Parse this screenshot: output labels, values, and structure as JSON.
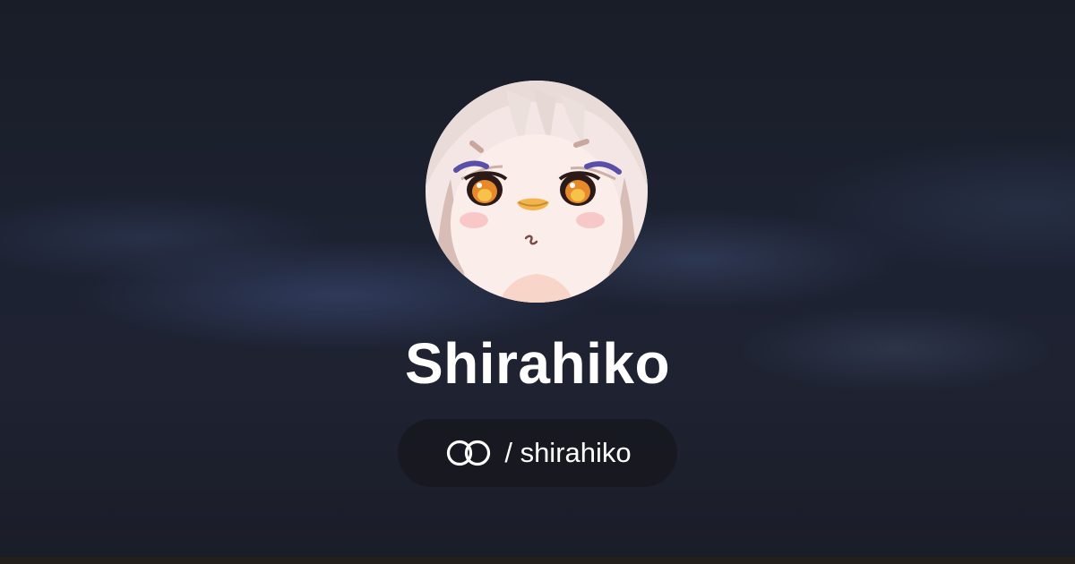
{
  "profile": {
    "display_name": "Shirahiko",
    "handle": "/ shirahiko",
    "avatar": "avatar-image"
  },
  "icons": {
    "platform": "linked-rings-icon"
  },
  "colors": {
    "background": "#1c2130",
    "text": "#ffffff",
    "pill_background": "#16181e"
  }
}
